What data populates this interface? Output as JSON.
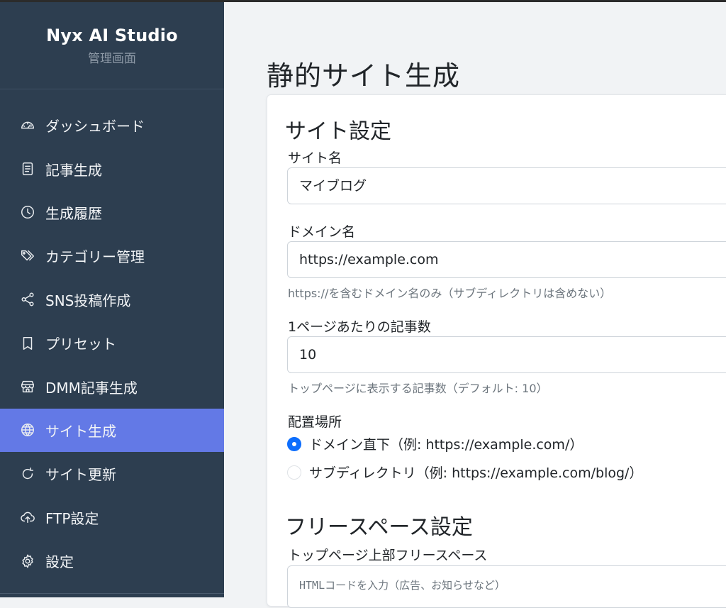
{
  "brand": {
    "title": "Nyx AI Studio",
    "subtitle": "管理画面"
  },
  "sidebar": {
    "items": [
      {
        "label": "ダッシュボード",
        "icon": "speedometer-icon",
        "active": false
      },
      {
        "label": "記事生成",
        "icon": "document-icon",
        "active": false
      },
      {
        "label": "生成履歴",
        "icon": "clock-icon",
        "active": false
      },
      {
        "label": "カテゴリー管理",
        "icon": "tags-icon",
        "active": false
      },
      {
        "label": "SNS投稿作成",
        "icon": "share-icon",
        "active": false
      },
      {
        "label": "プリセット",
        "icon": "bookmark-icon",
        "active": false
      },
      {
        "label": "DMM記事生成",
        "icon": "shop-icon",
        "active": false
      },
      {
        "label": "サイト生成",
        "icon": "globe-icon",
        "active": true
      },
      {
        "label": "サイト更新",
        "icon": "refresh-icon",
        "active": false
      },
      {
        "label": "FTP設定",
        "icon": "cloud-upload-icon",
        "active": false
      },
      {
        "label": "設定",
        "icon": "gear-icon",
        "active": false
      }
    ]
  },
  "page": {
    "title": "静的サイト生成"
  },
  "site_settings": {
    "heading": "サイト設定",
    "site_name": {
      "label": "サイト名",
      "value": "マイブログ"
    },
    "domain": {
      "label": "ドメイン名",
      "value": "https://example.com",
      "help": "https://を含むドメイン名のみ（サブディレクトリは含めない）"
    },
    "per_page": {
      "label": "1ページあたりの記事数",
      "value": "10",
      "help": "トップページに表示する記事数（デフォルト: 10）"
    },
    "placement": {
      "label": "配置場所",
      "options": [
        {
          "label": "ドメイン直下（例: https://example.com/）",
          "checked": true
        },
        {
          "label": "サブディレクトリ（例: https://example.com/blog/）",
          "checked": false
        }
      ]
    }
  },
  "free_space": {
    "heading": "フリースペース設定",
    "top_label": "トップページ上部フリースペース",
    "top_placeholder": "HTMLコードを入力（広告、お知らせなど）"
  },
  "colors": {
    "sidebar_bg": "#2d3e50",
    "active_bg": "#6379e6",
    "radio_checked": "#0d6efd"
  }
}
